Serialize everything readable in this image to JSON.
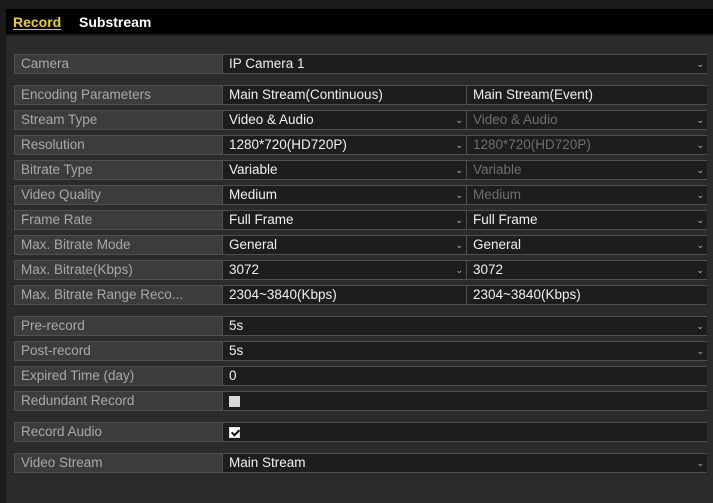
{
  "tabs": [
    {
      "label": "Record",
      "active": true
    },
    {
      "label": "Substream",
      "active": false
    }
  ],
  "camera": {
    "label": "Camera",
    "value": "IP Camera 1"
  },
  "encoding": {
    "header": {
      "label": "Encoding Parameters",
      "col1": "Main Stream(Continuous)",
      "col2": "Main Stream(Event)"
    },
    "rows": [
      {
        "label": "Stream Type",
        "col1": "Video & Audio",
        "col2": "Video & Audio"
      },
      {
        "label": "Resolution",
        "col1": "1280*720(HD720P)",
        "col2": "1280*720(HD720P)"
      },
      {
        "label": "Bitrate Type",
        "col1": "Variable",
        "col2": "Variable"
      },
      {
        "label": "Video Quality",
        "col1": "Medium",
        "col2": "Medium"
      },
      {
        "label": "Frame Rate",
        "col1": "Full Frame",
        "col2": "Full Frame"
      },
      {
        "label": "Max. Bitrate Mode",
        "col1": "General",
        "col2": "General"
      },
      {
        "label": "Max. Bitrate(Kbps)",
        "col1": "3072",
        "col2": "3072"
      },
      {
        "label": "Max. Bitrate Range Reco...",
        "col1": "2304~3840(Kbps)",
        "col2": "2304~3840(Kbps)"
      }
    ]
  },
  "record": {
    "pre_record": {
      "label": "Pre-record",
      "value": "5s"
    },
    "post_record": {
      "label": "Post-record",
      "value": "5s"
    },
    "expired_time": {
      "label": "Expired Time (day)",
      "value": "0"
    },
    "redundant_record": {
      "label": "Redundant Record",
      "checked": false
    },
    "record_audio": {
      "label": "Record Audio",
      "checked": true
    },
    "video_stream": {
      "label": "Video Stream",
      "value": "Main Stream"
    }
  },
  "icons": {
    "dropdown": "chevron-down-icon",
    "checkbox": "checkbox-icon"
  },
  "colors": {
    "active_tab": "#f4d100",
    "label_text": "#a9a9a9",
    "disabled_text": "#6e6e6e"
  }
}
